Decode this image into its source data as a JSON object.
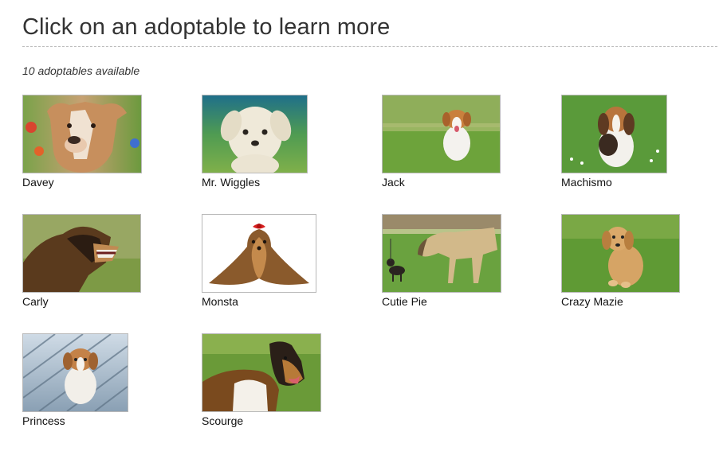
{
  "page": {
    "title": "Click on an adoptable to learn more",
    "count_text": "10 adoptables available"
  },
  "adoptables": [
    {
      "name": "Davey",
      "photo": "pit-bull-photo"
    },
    {
      "name": "Mr. Wiggles",
      "photo": "white-puppy-photo"
    },
    {
      "name": "Jack",
      "photo": "beagle-puppy-running-photo"
    },
    {
      "name": "Machismo",
      "photo": "beagle-puppy-sitting-photo"
    },
    {
      "name": "Carly",
      "photo": "german-shepherd-snarling-photo"
    },
    {
      "name": "Monsta",
      "photo": "yorkshire-terrier-photo"
    },
    {
      "name": "Cutie Pie",
      "photo": "great-dane-and-chihuahua-photo"
    },
    {
      "name": "Crazy Mazie",
      "photo": "golden-puppy-photo"
    },
    {
      "name": "Princess",
      "photo": "puppy-on-deck-photo"
    },
    {
      "name": "Scourge",
      "photo": "collie-lying-photo"
    }
  ]
}
